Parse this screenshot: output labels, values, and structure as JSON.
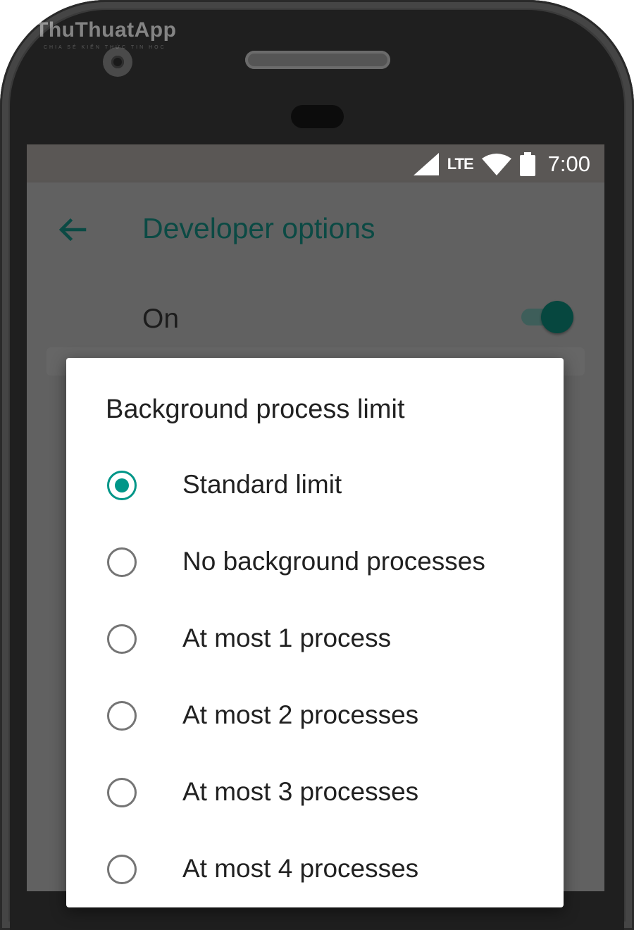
{
  "watermark": {
    "brand": "ThuThuatApp",
    "tagline": "CHIA SẺ KIẾN THỨC TIN HỌC"
  },
  "status_bar": {
    "network_label": "LTE",
    "time": "7:00",
    "icons": [
      "signal-icon",
      "wifi-icon",
      "battery-icon"
    ]
  },
  "app_bar": {
    "back_icon": "arrow-left-icon",
    "title": "Developer options"
  },
  "master_toggle": {
    "label": "On",
    "state": "on"
  },
  "dialog": {
    "title": "Background process limit",
    "selected_index": 0,
    "options": [
      {
        "label": "Standard limit",
        "checked": true
      },
      {
        "label": "No background processes",
        "checked": false
      },
      {
        "label": "At most 1 process",
        "checked": false
      },
      {
        "label": "At most 2 processes",
        "checked": false
      },
      {
        "label": "At most 3 processes",
        "checked": false
      },
      {
        "label": "At most 4 processes",
        "checked": false
      }
    ]
  },
  "colors": {
    "accent": "#009688",
    "title_dark_teal": "#0b4a44",
    "scrim": "#616161"
  }
}
